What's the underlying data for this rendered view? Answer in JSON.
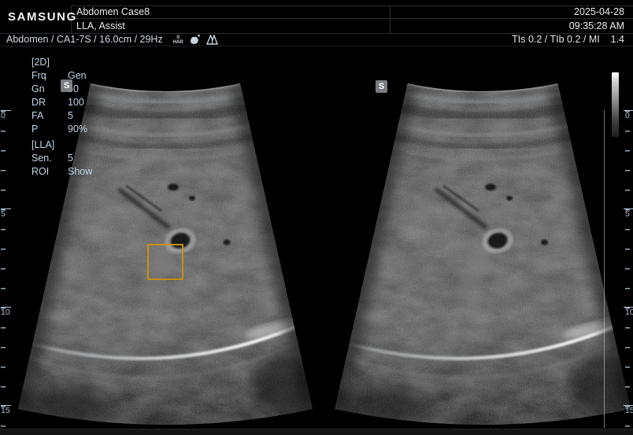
{
  "header": {
    "logo": "SAMSUNG",
    "patient_name": "Abdomen Case8",
    "operator": "LLA, Assist",
    "date": "2025-04-28",
    "time": "09:35:28 AM",
    "preset_line": "Abdomen / CA1-7S / 16.0cm / 29Hz",
    "har_icon_top": "S",
    "har_icon_bottom": "HAR",
    "ti_line": "TIs 0.2 / TIb 0.2 / MI    1.4"
  },
  "params": {
    "mode_header": "[2D]",
    "rows": [
      {
        "label": "Frq",
        "value": "Gen"
      },
      {
        "label": "Gn",
        "value": "50"
      },
      {
        "label": "DR",
        "value": "100"
      },
      {
        "label": "FA",
        "value": "5"
      },
      {
        "label": "P",
        "value": "90%"
      }
    ],
    "preset_header": "[LLA]",
    "rows2": [
      {
        "label": "Sen.",
        "value": "5"
      },
      {
        "label": "ROI",
        "value": "Show"
      }
    ]
  },
  "images": {
    "left_marker": "S",
    "right_marker": "S"
  },
  "ruler": {
    "labels": [
      "0",
      "5",
      "10",
      "15"
    ]
  },
  "colors": {
    "roi_box": "#c98f12",
    "param_text": "#c2d4e4",
    "ruler_text": "#a9c0d4"
  }
}
